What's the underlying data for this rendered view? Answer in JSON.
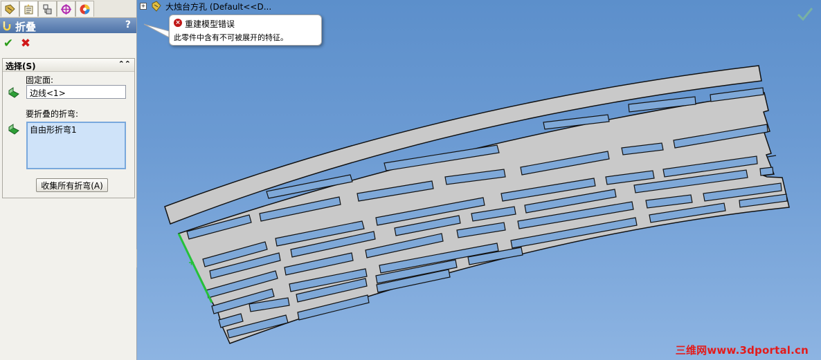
{
  "feature_manager": {
    "title": "折叠",
    "help": "?",
    "tabs": [
      {
        "name": "feature-manager-tab-icon"
      },
      {
        "name": "property-manager-tab-icon"
      },
      {
        "name": "configuration-manager-tab-icon"
      },
      {
        "name": "dimxpert-tab-icon"
      },
      {
        "name": "display-manager-tab-icon"
      }
    ]
  },
  "actions": {
    "ok": "✔",
    "cancel": "✖"
  },
  "selection": {
    "header": "选择(S)",
    "fixed_face_label": "固定面:",
    "fixed_face_value": "边线<1>",
    "bends_label": "要折叠的折弯:",
    "bends_value": "自由形折弯1",
    "collect_button": "收集所有折弯(A)"
  },
  "tree": {
    "part_name": "大烛台方孔  (Default<<D..."
  },
  "error_tooltip": {
    "title": "重建模型错误",
    "message": "此零件中含有不可被展开的特征。"
  },
  "watermark": "三维网www.3dportal.cn",
  "colors": {
    "viewport_top": "#5c8fcb",
    "viewport_bottom": "#8db4e2",
    "part_fill": "#c9c9c9",
    "selected_edge": "#25c13a"
  }
}
